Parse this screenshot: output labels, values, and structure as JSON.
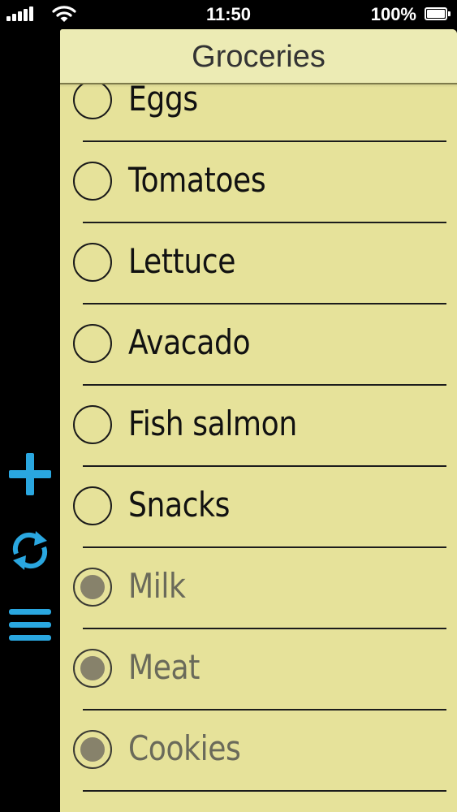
{
  "status_bar": {
    "time": "11:50",
    "battery_percent": "100%",
    "signal_bars": 5,
    "icons": [
      "signal-icon",
      "wifi-icon",
      "battery-icon"
    ]
  },
  "sidebar": {
    "accent_color": "#2aa7e0",
    "buttons": [
      {
        "name": "add-button",
        "icon": "plus-icon"
      },
      {
        "name": "sync-button",
        "icon": "refresh-icon"
      },
      {
        "name": "menu-button",
        "icon": "hamburger-icon"
      }
    ]
  },
  "note": {
    "title": "Groceries",
    "paper_color": "#e6e29a",
    "items": [
      {
        "label": "Eggs",
        "checked": false
      },
      {
        "label": "Tomatoes",
        "checked": false
      },
      {
        "label": "Lettuce",
        "checked": false
      },
      {
        "label": "Avacado",
        "checked": false
      },
      {
        "label": "Fish salmon",
        "checked": false
      },
      {
        "label": "Snacks",
        "checked": false
      },
      {
        "label": "Milk",
        "checked": true
      },
      {
        "label": "Meat",
        "checked": true
      },
      {
        "label": "Cookies",
        "checked": true
      }
    ]
  }
}
